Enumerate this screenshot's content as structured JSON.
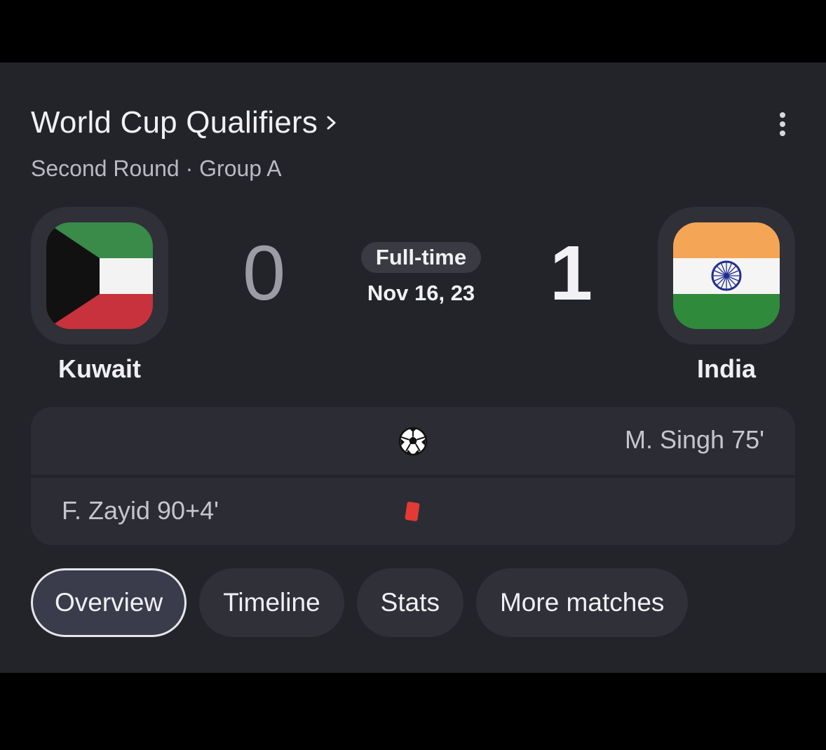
{
  "competition": {
    "title": "World Cup Qualifiers",
    "subtitle": "Second Round · Group A"
  },
  "match": {
    "status": "Full-time",
    "date": "Nov 16, 23",
    "home": {
      "name": "Kuwait",
      "score": "0",
      "flag_icon": "kuwait-flag-icon"
    },
    "away": {
      "name": "India",
      "score": "1",
      "flag_icon": "india-flag-icon"
    }
  },
  "events": [
    {
      "side": "away",
      "text": "M. Singh 75'",
      "icon": "soccer-ball-icon"
    },
    {
      "side": "home",
      "text": "F. Zayid 90+4'",
      "icon": "red-card-icon"
    }
  ],
  "tabs": [
    {
      "label": "Overview",
      "active": true
    },
    {
      "label": "Timeline",
      "active": false
    },
    {
      "label": "Stats",
      "active": false
    },
    {
      "label": "More matches",
      "active": false
    }
  ],
  "colors": {
    "card_bg": "#23242a",
    "red_card": "#e53935",
    "kuwait_green": "#3a8a4a",
    "kuwait_red": "#c8323c",
    "india_saffron": "#f4a556",
    "india_green": "#2f8a3b",
    "chakra_blue": "#1f2f8f"
  }
}
